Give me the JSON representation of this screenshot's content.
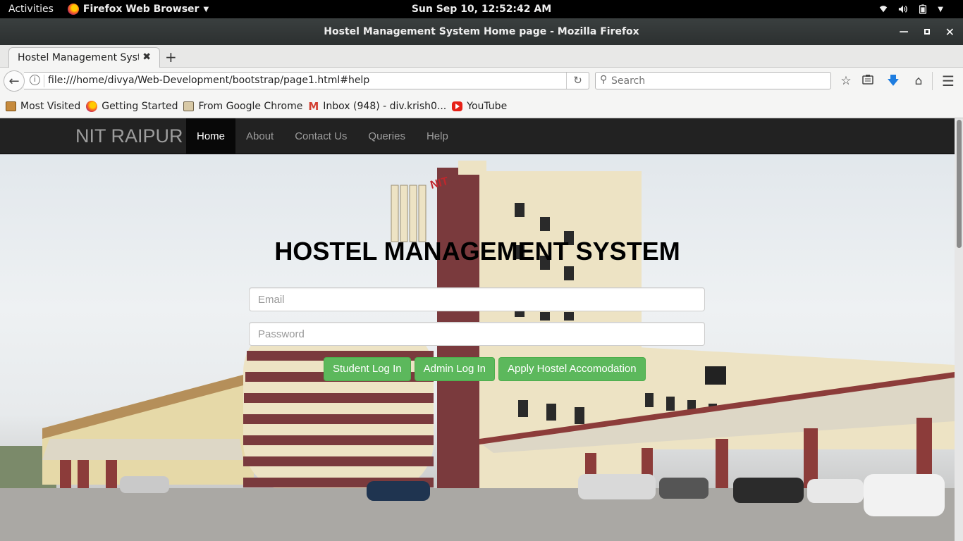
{
  "system_bar": {
    "activities": "Activities",
    "app_menu": "Firefox Web Browser",
    "clock": "Sun Sep 10, 12:52:42 AM"
  },
  "window": {
    "title": "Hostel Management System Home page - Mozilla Firefox"
  },
  "tab": {
    "title": "Hostel Management System Home page"
  },
  "navbar": {
    "url": "file:///home/divya/Web-Development/bootstrap/page1.html#help",
    "search_placeholder": "Search"
  },
  "bookmarks": [
    {
      "label": "Most Visited",
      "icon": "most-visited-icon"
    },
    {
      "label": "Getting Started",
      "icon": "firefox-icon"
    },
    {
      "label": "From Google Chrome",
      "icon": "folder-icon"
    },
    {
      "label": "Inbox (948) - div.krish0...",
      "icon": "gmail-icon"
    },
    {
      "label": "YouTube",
      "icon": "youtube-icon"
    }
  ],
  "site": {
    "brand": "NIT RAIPUR",
    "nav": [
      "Home",
      "About",
      "Contact Us",
      "Queries",
      "Help"
    ],
    "active_nav": "Home",
    "heading": "HOSTEL MANAGEMENT SYSTEM",
    "email_placeholder": "Email",
    "password_placeholder": "Password",
    "buttons": {
      "student": "Student Log In",
      "admin": "Admin Log In",
      "apply": "Apply Hostel Accomodation"
    },
    "building_sign": "NIT"
  },
  "colors": {
    "navbar_bg": "#222222",
    "button_success": "#5cb85c",
    "building_maroon": "#7a3a3d",
    "building_cream": "#ede3c4"
  }
}
